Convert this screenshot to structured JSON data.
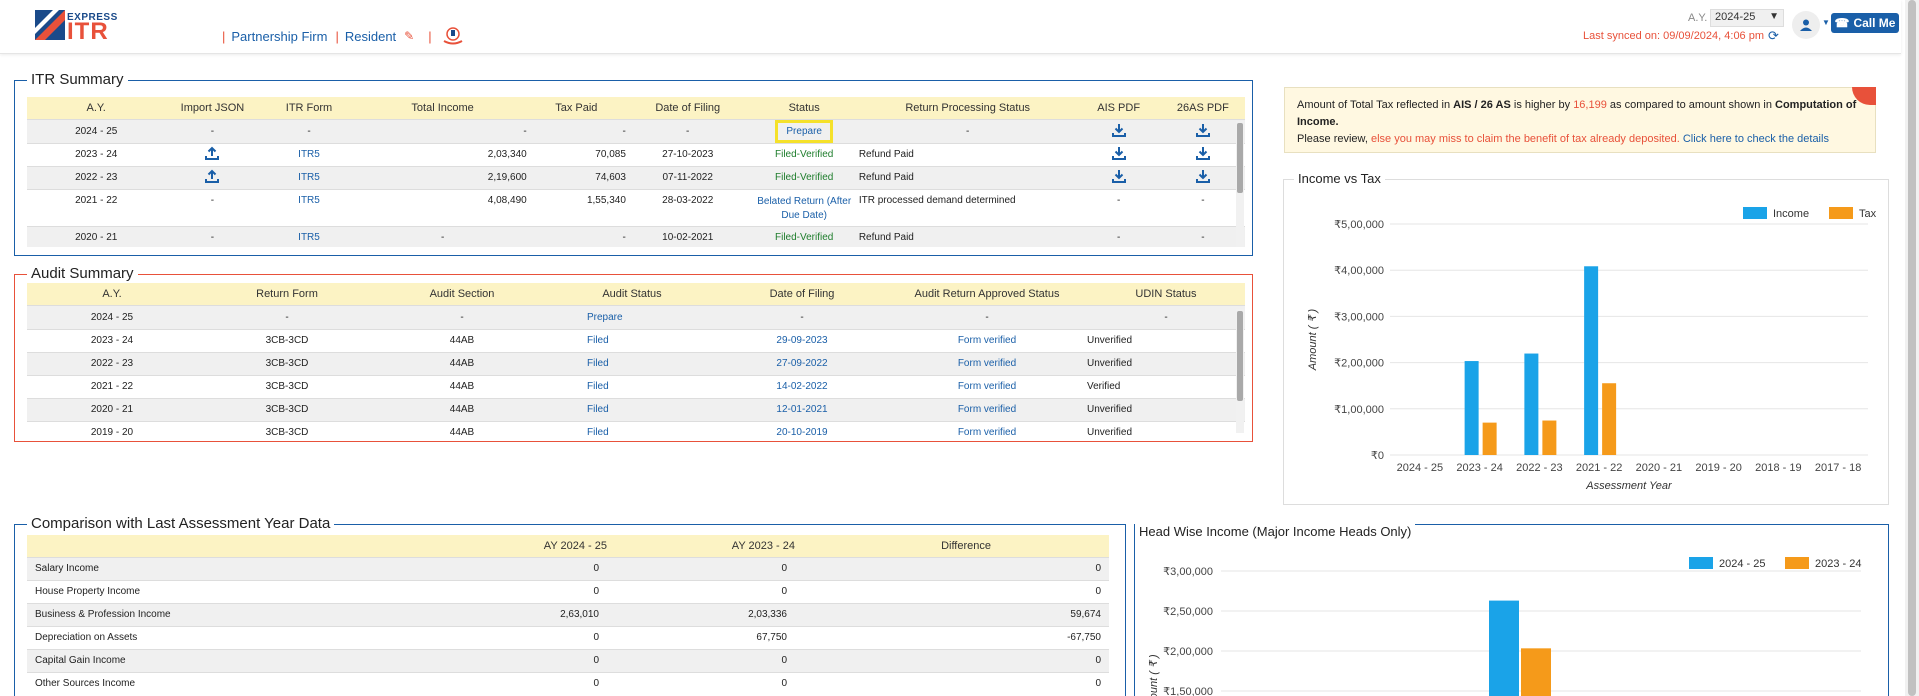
{
  "header": {
    "logo_top": "EXPRESS",
    "logo_main": "ITR",
    "crumbs": [
      "Partnership Firm",
      "Resident"
    ],
    "ay_label": "A.Y.",
    "ay_value": "2024-25",
    "last_synced": "Last synced on: 09/09/2024, 4:06 pm",
    "call_me": "Call Me"
  },
  "itr_summary": {
    "title": "ITR Summary",
    "columns": [
      "A.Y.",
      "Import JSON",
      "ITR Form",
      "Total Income",
      "Tax Paid",
      "Date of Filing",
      "Status",
      "Return Processing Status",
      "AIS PDF",
      "26AS PDF"
    ],
    "rows": [
      {
        "ay": "2024 - 25",
        "import": "-",
        "form": "-",
        "income": "-",
        "tax": "-",
        "date": "-",
        "status": "Prepare",
        "processing": "-",
        "ais": "download",
        "as26": "download"
      },
      {
        "ay": "2023 - 24",
        "import": "upload",
        "form": "ITR5",
        "income": "2,03,340",
        "tax": "70,085",
        "date": "27-10-2023",
        "status": "Filed-Verified",
        "processing": "Refund Paid",
        "ais": "download",
        "as26": "download"
      },
      {
        "ay": "2022 - 23",
        "import": "upload",
        "form": "ITR5",
        "income": "2,19,600",
        "tax": "74,603",
        "date": "07-11-2022",
        "status": "Filed-Verified",
        "processing": "Refund Paid",
        "ais": "download",
        "as26": "download"
      },
      {
        "ay": "2021 - 22",
        "import": "-",
        "form": "ITR5",
        "income": "4,08,490",
        "tax": "1,55,340",
        "date": "28-03-2022",
        "status": "Belated Return (After Due Date)",
        "processing": "ITR processed demand determined",
        "ais": "-",
        "as26": "-"
      },
      {
        "ay": "2020 - 21",
        "import": "-",
        "form": "ITR5",
        "income": "-",
        "tax": "-",
        "date": "10-02-2021",
        "status": "Filed-Verified",
        "processing": "Refund Paid",
        "ais": "-",
        "as26": "-"
      }
    ]
  },
  "audit_summary": {
    "title": "Audit Summary",
    "columns": [
      "A.Y.",
      "Return Form",
      "Audit Section",
      "Audit Status",
      "Date of Filing",
      "Audit Return Approved Status",
      "UDIN Status"
    ],
    "rows": [
      {
        "ay": "2024 - 25",
        "form": "-",
        "section": "-",
        "status": "Prepare",
        "date": "-",
        "approved": "-",
        "udin": "-"
      },
      {
        "ay": "2023 - 24",
        "form": "3CB-3CD",
        "section": "44AB",
        "status": "Filed",
        "date": "29-09-2023",
        "approved": "Form verified",
        "udin": "Unverified"
      },
      {
        "ay": "2022 - 23",
        "form": "3CB-3CD",
        "section": "44AB",
        "status": "Filed",
        "date": "27-09-2022",
        "approved": "Form verified",
        "udin": "Unverified"
      },
      {
        "ay": "2021 - 22",
        "form": "3CB-3CD",
        "section": "44AB",
        "status": "Filed",
        "date": "14-02-2022",
        "approved": "Form verified",
        "udin": "Verified"
      },
      {
        "ay": "2020 - 21",
        "form": "3CB-3CD",
        "section": "44AB",
        "status": "Filed",
        "date": "12-01-2021",
        "approved": "Form verified",
        "udin": "Unverified"
      },
      {
        "ay": "2019 - 20",
        "form": "3CB-3CD",
        "section": "44AB",
        "status": "Filed",
        "date": "20-10-2019",
        "approved": "Form verified",
        "udin": "Unverified"
      }
    ]
  },
  "alert": {
    "t1": "Amount of Total Tax reflected in ",
    "t2": "AIS / 26 AS",
    "t3": " is higher by ",
    "t4": "16,199",
    "t5": " as compared to amount shown in ",
    "t6": "Computation of Income.",
    "t7": "Please review, ",
    "t8": "else you may miss to claim the benefit of tax already deposited.",
    "t9": " Click here to check the details"
  },
  "comparison": {
    "title": "Comparison with Last Assessment Year Data",
    "columns": [
      "",
      "AY 2024 - 25",
      "AY 2023 - 24",
      "Difference"
    ],
    "rows": [
      {
        "label": "Salary Income",
        "a": "0",
        "b": "0",
        "d": "0"
      },
      {
        "label": "House Property Income",
        "a": "0",
        "b": "0",
        "d": "0"
      },
      {
        "label": "Business & Profession Income",
        "a": "2,63,010",
        "b": "2,03,336",
        "d": "59,674"
      },
      {
        "label": "Depreciation on Assets",
        "a": "0",
        "b": "67,750",
        "d": "-67,750"
      },
      {
        "label": "Capital Gain Income",
        "a": "0",
        "b": "0",
        "d": "0"
      },
      {
        "label": "Other Sources Income",
        "a": "0",
        "b": "0",
        "d": "0"
      }
    ]
  },
  "chart_data": [
    {
      "type": "bar",
      "title": "Income vs Tax",
      "xlabel": "Assessment Year",
      "ylabel": "Amount ( ₹ )",
      "categories": [
        "2024 - 25",
        "2023 - 24",
        "2022 - 23",
        "2021 - 22",
        "2020 - 21",
        "2019 - 20",
        "2018 - 19",
        "2017 - 18"
      ],
      "yticks": [
        "₹0",
        "₹1,00,000",
        "₹2,00,000",
        "₹3,00,000",
        "₹4,00,000",
        "₹5,00,000"
      ],
      "ylim": [
        0,
        500000
      ],
      "legend": "top-right",
      "series": [
        {
          "name": "Income",
          "color": "#1aa3e8",
          "values": [
            0,
            203340,
            219600,
            408490,
            0,
            0,
            0,
            0
          ]
        },
        {
          "name": "Tax",
          "color": "#f59a1a",
          "values": [
            0,
            70085,
            74603,
            155340,
            0,
            0,
            0,
            0
          ]
        }
      ]
    },
    {
      "type": "bar",
      "title": "Head Wise Income (Major Income Heads Only)",
      "ylabel": "Amount ( ₹ )",
      "yticks": [
        "₹1,50,000",
        "₹2,00,000",
        "₹2,50,000",
        "₹3,00,000"
      ],
      "legend": "top-right",
      "series": [
        {
          "name": "2024 - 25",
          "color": "#1aa3e8",
          "values": [
            263010
          ]
        },
        {
          "name": "2023 - 24",
          "color": "#f59a1a",
          "values": [
            203336
          ]
        }
      ]
    }
  ]
}
